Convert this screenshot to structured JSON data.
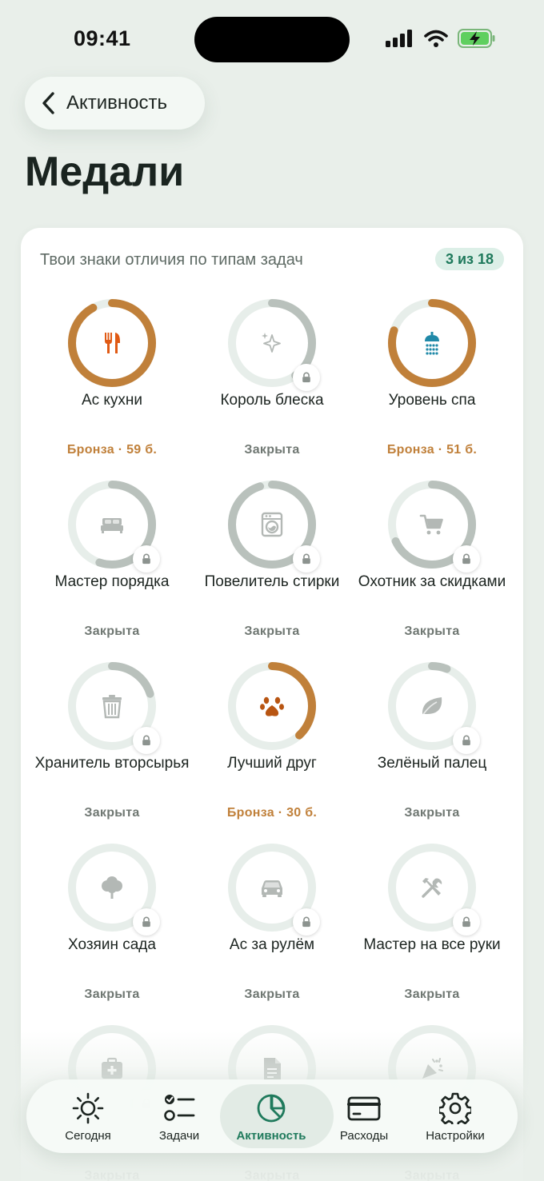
{
  "status_bar": {
    "time": "09:41"
  },
  "nav": {
    "back_label": "Активность"
  },
  "page": {
    "title": "Медали"
  },
  "card": {
    "subtitle": "Твои знаки отличия по типам задач",
    "count_badge": "3 из 18"
  },
  "medals": [
    {
      "name": "Ас кухни",
      "status": "Бронза · 59 б.",
      "progress": 0.92,
      "tier": "bronze",
      "locked": false,
      "icon": "utensils-icon"
    },
    {
      "name": "Король блеска",
      "status": "Закрыта",
      "progress": 0.4,
      "tier": "none",
      "locked": true,
      "icon": "sparkles-icon"
    },
    {
      "name": "Уровень спа",
      "status": "Бронза · 51 б.",
      "progress": 0.8,
      "tier": "bronze",
      "locked": false,
      "icon": "shower-icon"
    },
    {
      "name": "Мастер порядка",
      "status": "Закрыта",
      "progress": 0.55,
      "tier": "none",
      "locked": true,
      "icon": "bed-icon"
    },
    {
      "name": "Повелитель стирки",
      "status": "Закрыта",
      "progress": 0.95,
      "tier": "none",
      "locked": true,
      "icon": "washing-machine-icon"
    },
    {
      "name": "Охотник за скидками",
      "status": "Закрыта",
      "progress": 0.68,
      "tier": "none",
      "locked": true,
      "icon": "cart-icon"
    },
    {
      "name": "Хранитель вторсырья",
      "status": "Закрыта",
      "progress": 0.2,
      "tier": "none",
      "locked": true,
      "icon": "trash-icon"
    },
    {
      "name": "Лучший друг",
      "status": "Бронза · 30 б.",
      "progress": 0.38,
      "tier": "bronze",
      "locked": false,
      "icon": "paw-icon"
    },
    {
      "name": "Зелёный палец",
      "status": "Закрыта",
      "progress": 0.06,
      "tier": "none",
      "locked": true,
      "icon": "leaf-icon"
    },
    {
      "name": "Хозяин сада",
      "status": "Закрыта",
      "progress": 0.0,
      "tier": "none",
      "locked": true,
      "icon": "tree-icon"
    },
    {
      "name": "Ас за рулём",
      "status": "Закрыта",
      "progress": 0.0,
      "tier": "none",
      "locked": true,
      "icon": "car-icon"
    },
    {
      "name": "Мастер на все руки",
      "status": "Закрыта",
      "progress": 0.0,
      "tier": "none",
      "locked": true,
      "icon": "tools-icon"
    },
    {
      "name": "",
      "status": "Закрыта",
      "progress": 0.0,
      "tier": "none",
      "locked": true,
      "icon": "first-aid-icon"
    },
    {
      "name": "",
      "status": "Закрыта",
      "progress": 0.0,
      "tier": "none",
      "locked": true,
      "icon": "document-icon"
    },
    {
      "name": "",
      "status": "Закрыта",
      "progress": 0.0,
      "tier": "none",
      "locked": true,
      "icon": "party-popper-icon"
    }
  ],
  "tabs": [
    {
      "label": "Сегодня",
      "icon": "sun-icon",
      "active": false
    },
    {
      "label": "Задачи",
      "icon": "checklist-icon",
      "active": false
    },
    {
      "label": "Активность",
      "icon": "pie-chart-icon",
      "active": true
    },
    {
      "label": "Расходы",
      "icon": "credit-card-icon",
      "active": false
    },
    {
      "label": "Настройки",
      "icon": "gear-icon",
      "active": false
    }
  ],
  "colors": {
    "bronze": "#c0803a",
    "ring_track": "#e7eeea",
    "ring_locked": "#b9c1bc",
    "accent": "#1f7a5c",
    "icon_orange": "#e05a14",
    "icon_teal": "#2089a8",
    "icon_brown": "#b85512",
    "icon_gray": "#b3b8b5"
  }
}
